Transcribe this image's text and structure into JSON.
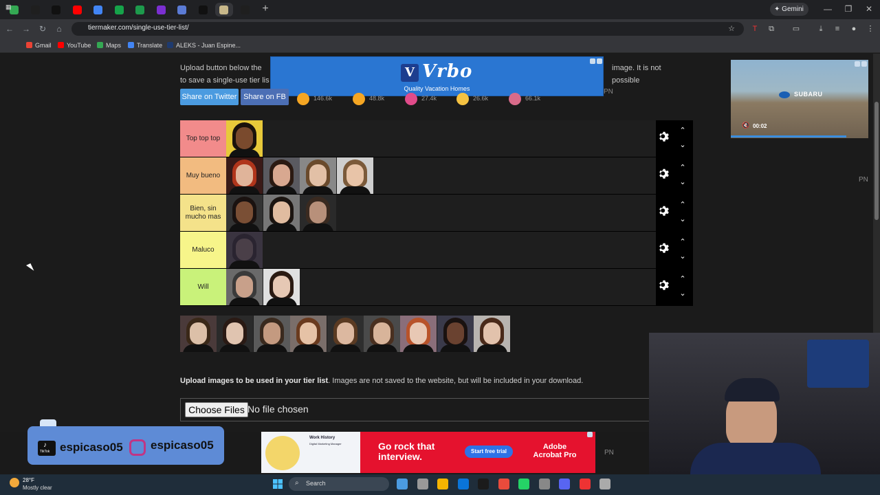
{
  "browser": {
    "url": "tiermaker.com/single-use-tier-list/",
    "gemini_label": "Gemini",
    "tab_colors": [
      "#34a853",
      "#1f1f1f",
      "#111111",
      "#ff0000",
      "#4285f4",
      "#16a34a",
      "#1d9a4c",
      "#7b2fd1",
      "#5b7bd5",
      "#111111",
      "#c8b88a",
      "#1f1f1f"
    ],
    "bookmarks": [
      {
        "label": "Gmail",
        "color": "#ea4335"
      },
      {
        "label": "YouTube",
        "color": "#ff0000"
      },
      {
        "label": "Maps",
        "color": "#34a853"
      },
      {
        "label": "Translate",
        "color": "#4285f4"
      },
      {
        "label": "ALEKS - Juan Espine...",
        "color": "#1e3a6e"
      }
    ]
  },
  "page": {
    "intro_text_line1": "Upload button below the",
    "intro_text_line1b": "image. It is not possible",
    "intro_text_line2": "to save a single-use tier lis",
    "share_twitter": "Share on Twitter",
    "share_fb": "Share on FB",
    "reactions": [
      {
        "count": "146.6k",
        "color": "#f5a623"
      },
      {
        "count": "48.8k",
        "color": "#f5a623"
      },
      {
        "count": "27.4k",
        "color": "#e14b8a"
      },
      {
        "count": "26.6k",
        "color": "#f5c242"
      },
      {
        "count": "66.1k",
        "color": "#d96b8a"
      }
    ],
    "vrbo": {
      "logo_letter": "V",
      "name": "Vrbo",
      "tagline": "Quality Vacation Homes"
    },
    "pn": "PN"
  },
  "tiers": [
    {
      "label": "Top top top",
      "color": "#f28b8b",
      "items": [
        {
          "skin": "#7a4a2d",
          "hair": "#1a120c",
          "bg": "#e8c93a"
        }
      ]
    },
    {
      "label": "Muy bueno",
      "color": "#f2bb80",
      "items": [
        {
          "skin": "#e0b49a",
          "hair": "#b0351b",
          "bg": "#3a1a18"
        },
        {
          "skin": "#d8a890",
          "hair": "#2b1a12",
          "bg": "#5a5a60"
        },
        {
          "skin": "#e2c0a6",
          "hair": "#6a4a2c",
          "bg": "#888"
        },
        {
          "skin": "#e8c4a8",
          "hair": "#7b5a3a",
          "bg": "#cfcfcf"
        }
      ]
    },
    {
      "label": "Bien, sin mucho mas",
      "color": "#f4e28a",
      "items": [
        {
          "skin": "#7a4f35",
          "hair": "#1a1210",
          "bg": "#333"
        },
        {
          "skin": "#e0bca0",
          "hair": "#1b1410",
          "bg": "#777"
        },
        {
          "skin": "#b8907a",
          "hair": "#3a2a20",
          "bg": "#2a2a2a"
        }
      ]
    },
    {
      "label": "Maluco",
      "color": "#f7f58a",
      "items": [
        {
          "skin": "#4a3f48",
          "hair": "#2a2430",
          "bg": "#3a3440"
        }
      ]
    },
    {
      "label": "Will",
      "color": "#c9f27a",
      "items": [
        {
          "skin": "#c8a08a",
          "hair": "#3a3a3a",
          "bg": "#6a6a6a"
        },
        {
          "skin": "#e6c8b4",
          "hair": "#2a1a12",
          "bg": "#e0e0e0"
        }
      ]
    }
  ],
  "pool": [
    {
      "skin": "#dcc0a8",
      "hair": "#3a2818",
      "bg": "#4a3a3a"
    },
    {
      "skin": "#e0c4b0",
      "hair": "#2a1a14",
      "bg": "#2a2a2a"
    },
    {
      "skin": "#c49a80",
      "hair": "#3a2a1e",
      "bg": "#5a5a5a"
    },
    {
      "skin": "#e6c2a6",
      "hair": "#6a3a1e",
      "bg": "#7a6e6a"
    },
    {
      "skin": "#dcb8a0",
      "hair": "#5a3a22",
      "bg": "#2e2e2e"
    },
    {
      "skin": "#d8b49a",
      "hair": "#4a3020",
      "bg": "#4a4a4a"
    },
    {
      "skin": "#e8c8b4",
      "hair": "#b8532a",
      "bg": "#8a6e7a"
    },
    {
      "skin": "#6a4230",
      "hair": "#1a1210",
      "bg": "#3a3a4a"
    },
    {
      "skin": "#e2c2ac",
      "hair": "#4a2a1a",
      "bg": "#b8b4b0"
    }
  ],
  "upload": {
    "bold": "Upload images to be used in your tier list",
    "rest": ". Images are not saved to the website, but will be included in your download.",
    "button": "Choose Files",
    "status": "No file chosen"
  },
  "video_ad": {
    "brand": "SUBARU",
    "time": "00:02",
    "progress": 0.84
  },
  "overlay": {
    "tiktok_handle": "espicaso05",
    "instagram_handle": "espicaso05",
    "tiktok_label": "TikTok"
  },
  "bottom_ad": {
    "headline": "Go rock that interview.",
    "cta": "Start free trial",
    "brand": "Adobe Acrobat Pro",
    "card_title": "Work History",
    "card_sub": "Digital Marketing Manager"
  },
  "taskbar": {
    "temp": "28°F",
    "desc": "Mostly clear",
    "search": "Search",
    "apps": [
      "#4b9be0",
      "#999",
      "#f5b400",
      "#0a74d8",
      "#1b1b1b",
      "#e94b3c",
      "#25d366",
      "#888",
      "#5865f2",
      "#e33",
      "#aaa"
    ]
  }
}
